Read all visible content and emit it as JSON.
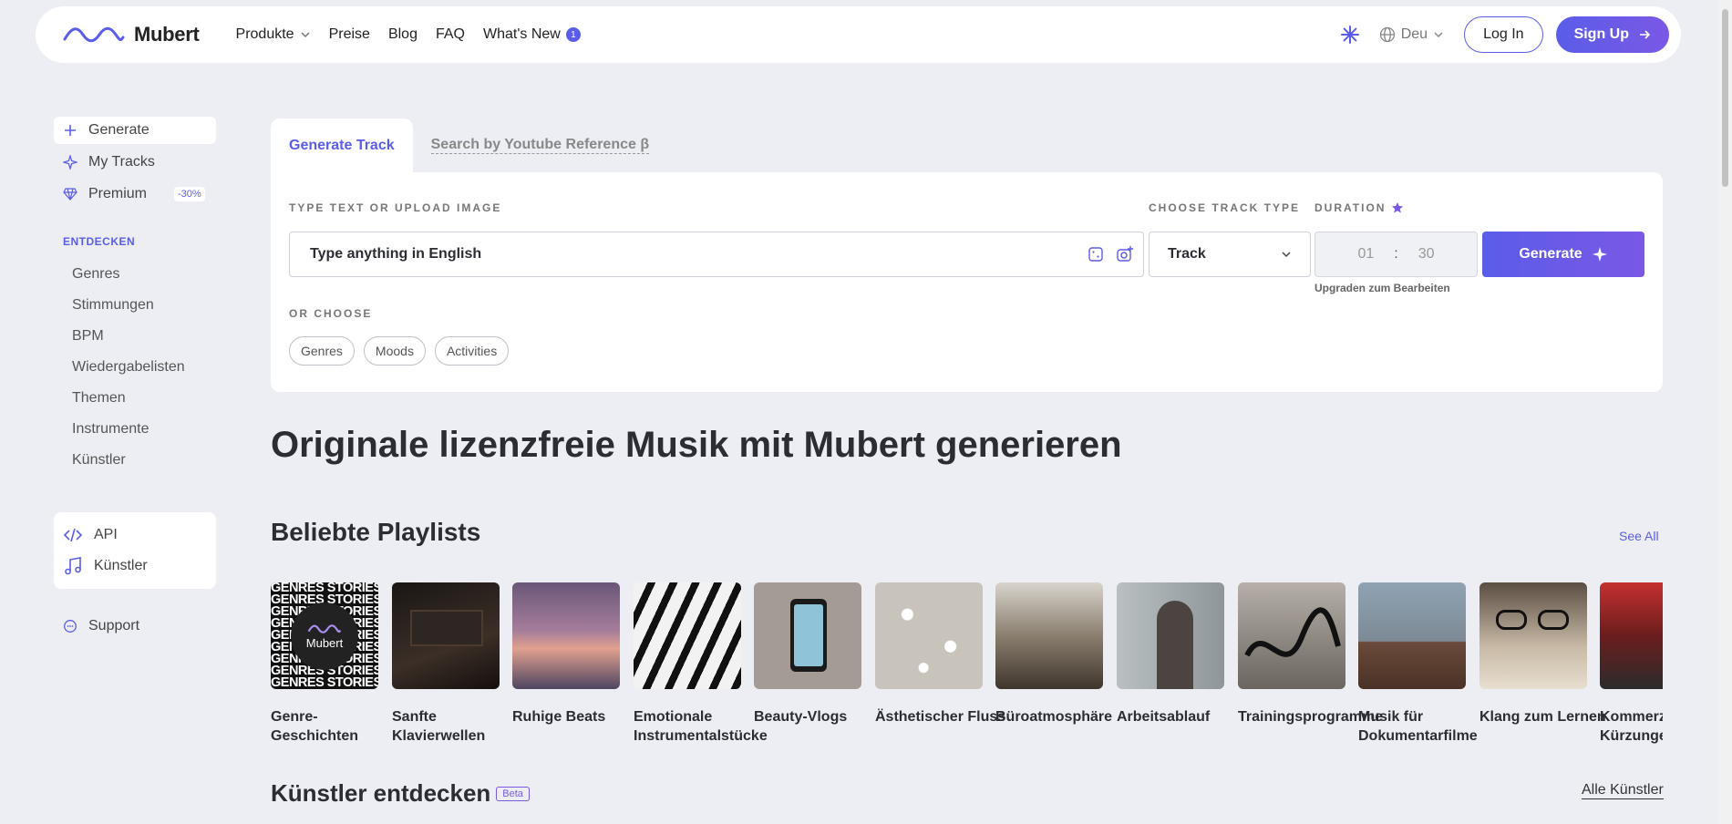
{
  "brand": {
    "name": "Mubert",
    "accent": "#5a5de8"
  },
  "nav": {
    "items": [
      {
        "label": "Produkte"
      },
      {
        "label": "Preise"
      },
      {
        "label": "Blog"
      },
      {
        "label": "FAQ"
      },
      {
        "label": "What's New",
        "badge": "1"
      }
    ],
    "language": "Deu",
    "login": "Log In",
    "signup": "Sign Up"
  },
  "sidebar": {
    "main": [
      {
        "label": "Generate",
        "icon": "plus-icon"
      },
      {
        "label": "My Tracks",
        "icon": "sparkle-icon"
      },
      {
        "label": "Premium",
        "icon": "diamond-icon",
        "badge": "-30%"
      }
    ],
    "discover_title": "ENTDECKEN",
    "discover": [
      "Genres",
      "Stimmungen",
      "BPM",
      "Wiedergabelisten",
      "Themen",
      "Instrumente",
      "Künstler"
    ],
    "box": [
      {
        "label": "API",
        "icon": "code-icon"
      },
      {
        "label": "Künstler",
        "icon": "music-note-icon"
      }
    ],
    "support": "Support"
  },
  "generator": {
    "tabs": [
      "Generate Track",
      "Search by Youtube Reference β"
    ],
    "text_label": "TYPE TEXT OR UPLOAD IMAGE",
    "text_placeholder": "Type anything in English",
    "track_type_label": "CHOOSE TRACK TYPE",
    "track_type_value": "Track",
    "duration_label": "DURATION",
    "duration_min": "01",
    "duration_sec": "30",
    "upgrade_note": "Upgraden zum Bearbeiten",
    "generate_button": "Generate",
    "or_choose": "OR CHOOSE",
    "chips": [
      "Genres",
      "Moods",
      "Activities"
    ]
  },
  "headline": "Originale lizenzfreie Musik mit Mubert generieren",
  "playlists": {
    "title": "Beliebte Playlists",
    "see_all": "See All",
    "items": [
      {
        "name": "Genre-Geschichten",
        "bg": "#1a1a1a"
      },
      {
        "name": "Sanfte Klavierwellen",
        "bg": "#2a2320"
      },
      {
        "name": "Ruhige Beats",
        "bg": "#8a6a88"
      },
      {
        "name": "Emotionale Instrumentalstücke",
        "bg": "#222222"
      },
      {
        "name": "Beauty-Vlogs",
        "bg": "#a59b95"
      },
      {
        "name": "Ästhetischer Fluss",
        "bg": "#c9c4bb"
      },
      {
        "name": "Büroatmosphäre",
        "bg": "#5a5146"
      },
      {
        "name": "Arbeitsablauf",
        "bg": "#9aa3a8"
      },
      {
        "name": "Trainingsprogramme",
        "bg": "#5d5a55"
      },
      {
        "name": "Musik für Dokumentarfilme",
        "bg": "#7d8a95"
      },
      {
        "name": "Klang zum Lernen",
        "bg": "#8a7a6a"
      },
      {
        "name": "Kommerz Kürzunge",
        "bg": "#c53030"
      }
    ]
  },
  "artists": {
    "title": "Künstler entdecken",
    "beta": "Beta",
    "all": "Alle Künstler"
  }
}
